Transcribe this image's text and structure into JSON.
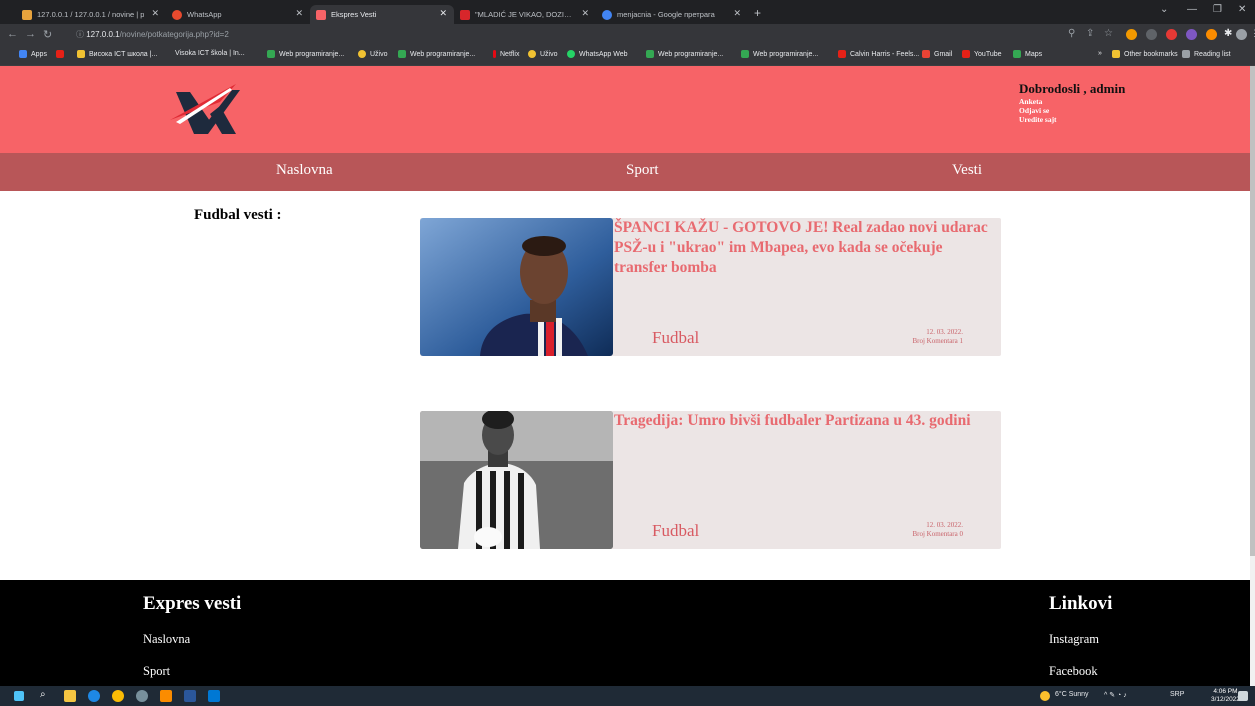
{
  "browser": {
    "tabs": [
      {
        "title": "127.0.0.1 / 127.0.0.1 / novine | p",
        "color": "#e8a33d"
      },
      {
        "title": "WhatsApp",
        "color": "#e84a2e"
      },
      {
        "title": "Ekspres Vesti",
        "color": "#f76367"
      },
      {
        "title": "\"MLADIĆ JE VIKAO, DOZIVAO PO",
        "color": "#d7262b"
      },
      {
        "title": "menjacnia - Google претрага",
        "color": "#4285f4"
      }
    ],
    "url_host": "127.0.0.1",
    "url_path": "/novine/potkategorija.php?id=2",
    "bookmarks": [
      {
        "label": "Apps",
        "color": "#4285f4"
      },
      {
        "label": "",
        "color": "#e62117"
      },
      {
        "label": "Висока ICT школа |...",
        "color": "#f1c232"
      },
      {
        "label": "Visoka ICT škola | In...",
        "color": "#35363a"
      },
      {
        "label": "Web programiranje...",
        "color": "#34a853"
      },
      {
        "label": "Uživo",
        "color": "#f1c232"
      },
      {
        "label": "Web programiranje...",
        "color": "#34a853"
      },
      {
        "label": "Netflix",
        "color": "#e50914"
      },
      {
        "label": "Uživo",
        "color": "#f1c232"
      },
      {
        "label": "WhatsApp Web",
        "color": "#25d366"
      },
      {
        "label": "Web programiranje...",
        "color": "#34a853"
      },
      {
        "label": "Web programiranje...",
        "color": "#34a853"
      },
      {
        "label": "Calvin Harris - Feels...",
        "color": "#e62117"
      },
      {
        "label": "Gmail",
        "color": "#ea4335"
      },
      {
        "label": "YouTube",
        "color": "#e62117"
      },
      {
        "label": "Maps",
        "color": "#34a853"
      },
      {
        "label": "Other bookmarks",
        "color": "#f1c232"
      },
      {
        "label": "Reading list",
        "color": "#9aa0a6"
      }
    ]
  },
  "header": {
    "greeting": "Dobrodosli , admin",
    "links": [
      "Anketa",
      "Odjavi se",
      "Uredite sajt"
    ]
  },
  "nav": {
    "items": [
      "Naslovna",
      "Sport",
      "Vesti"
    ]
  },
  "main": {
    "side_title": "Fudbal vesti :",
    "articles": [
      {
        "headline": "ŠPANCI KAŽU - GOTOVO JE! Real zadao novi udarac PSŽ-u i \"ukrao\" im Mbapea, evo kada se očekuje transfer bomba",
        "category": "Fudbal",
        "date": "12. 03. 2022.",
        "comments": "Broj Komentara 1"
      },
      {
        "headline": "Tragedija: Umro bivši fudbaler Partizana u 43. godini",
        "category": "Fudbal",
        "date": "12. 03. 2022.",
        "comments": "Broj Komentara 0"
      }
    ]
  },
  "footer": {
    "left_title": "Expres vesti",
    "left_links": [
      "Naslovna",
      "Sport"
    ],
    "right_title": "Linkovi",
    "right_links": [
      "Instagram",
      "Facebook"
    ]
  },
  "taskbar": {
    "weather": "6°C Sunny",
    "lang": "SRP",
    "time": "4:06 PM",
    "date": "3/12/2022"
  },
  "colors": {
    "header_bg": "#f76367",
    "nav_bg": "#b85658",
    "card_bg": "#ece5e5",
    "headline": "#e86a70"
  }
}
